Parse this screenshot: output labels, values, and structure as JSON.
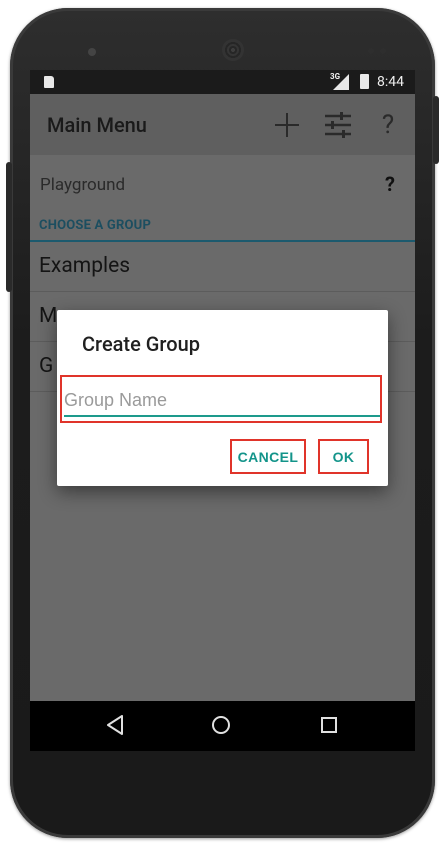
{
  "status_bar": {
    "network": "3G",
    "time": "8:44"
  },
  "app_bar": {
    "title": "Main Menu",
    "icons": [
      "plus-icon",
      "tune-icon",
      "help-icon"
    ],
    "help_glyph": "?"
  },
  "playground": {
    "label": "Playground",
    "help_glyph": "?"
  },
  "section_header": "CHOOSE A GROUP",
  "groups": [
    "Examples",
    "M",
    "G"
  ],
  "dialog": {
    "title": "Create Group",
    "input_placeholder": "Group Name",
    "input_value": "",
    "cancel_label": "CANCEL",
    "ok_label": "OK"
  },
  "nav_bar": {
    "icons": [
      "back-icon",
      "home-icon",
      "recents-icon"
    ]
  },
  "colors": {
    "accent": "#13948a",
    "highlight_box": "#e0342a",
    "section_header": "#1c4e60",
    "overlay_bg": "#6a6a6a"
  }
}
